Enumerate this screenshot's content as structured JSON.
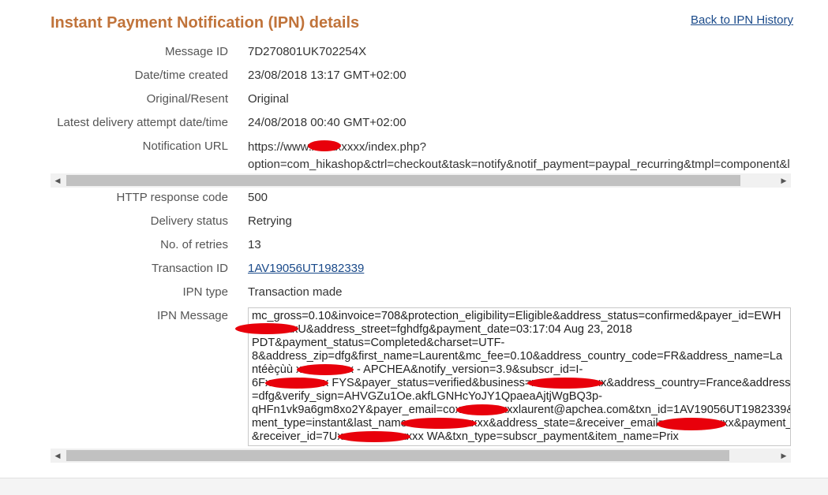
{
  "header": {
    "title": "Instant Payment Notification (IPN) details",
    "back_link": "Back to IPN History"
  },
  "details": [
    {
      "label": "Message ID",
      "value": "7D270801UK702254X"
    },
    {
      "label": "Date/time created",
      "value": "23/08/2018 13:17 GMT+02:00"
    },
    {
      "label": "Original/Resent",
      "value": "Original"
    },
    {
      "label": "Latest delivery attempt date/time",
      "value": "24/08/2018 00:40 GMT+02:00"
    }
  ],
  "notification_url": {
    "label": "Notification URL",
    "line1": "https://www.xxxxxxxxx/index.php?",
    "line2": "option=com_hikashop&ctrl=checkout&task=notify&notif_payment=paypal_recurring&tmpl=component&l"
  },
  "details2": [
    {
      "label": "HTTP response code",
      "value": "500"
    },
    {
      "label": "Delivery status",
      "value": "Retrying"
    },
    {
      "label": "No. of retries",
      "value": "13"
    },
    {
      "label": "Transaction ID",
      "value": "1AV19056UT1982339"
    },
    {
      "label": "IPN type",
      "value": "Transaction made"
    }
  ],
  "ipn_message": {
    "label": "IPN Message",
    "lines": [
      "mc_gross=0.10&invoice=708&protection_eligibility=Eligible&address_status=confirmed&payer_id=EWH",
      "xxxxxxxxU&address_street=fghdfg&payment_date=03:17:04 Aug 23, 2018",
      "PDT&payment_status=Completed&charset=UTF-",
      "8&address_zip=dfg&first_name=Laurent&mc_fee=0.10&address_country_code=FR&address_name=La",
      "ntéèçùù xxxxxxxxxx - APCHEA&notify_version=3.9&subscr_id=I-",
      "6Fxxxxxxxxxxx FYS&payer_status=verified&business=xxxxxxxxxxxxx&address_country=France&address_",
      "=dfg&verify_sign=AHVGZu1Oe.akfLGNHcYoJY1QpaeaAjtjWgBQ3p-",
      "qHFn1vk9a6gm8xo2Y&payer_email=coxxxxxxxxxxxlaurent@apchea.com&txn_id=1AV19056UT1982339&",
      "ment_type=instant&last_name=xxxxxxxxxxxxx&address_state=&receiver_email=xxxxxxxxxxxx&payment_f",
      "&receiver_id=7Uxxxxxxxxxxxxxxx WA&txn_type=subscr_payment&item_name=Prix"
    ]
  },
  "colors": {
    "title": "#c0733a",
    "link": "#1a4a8a",
    "redaction": "#e8000b"
  }
}
